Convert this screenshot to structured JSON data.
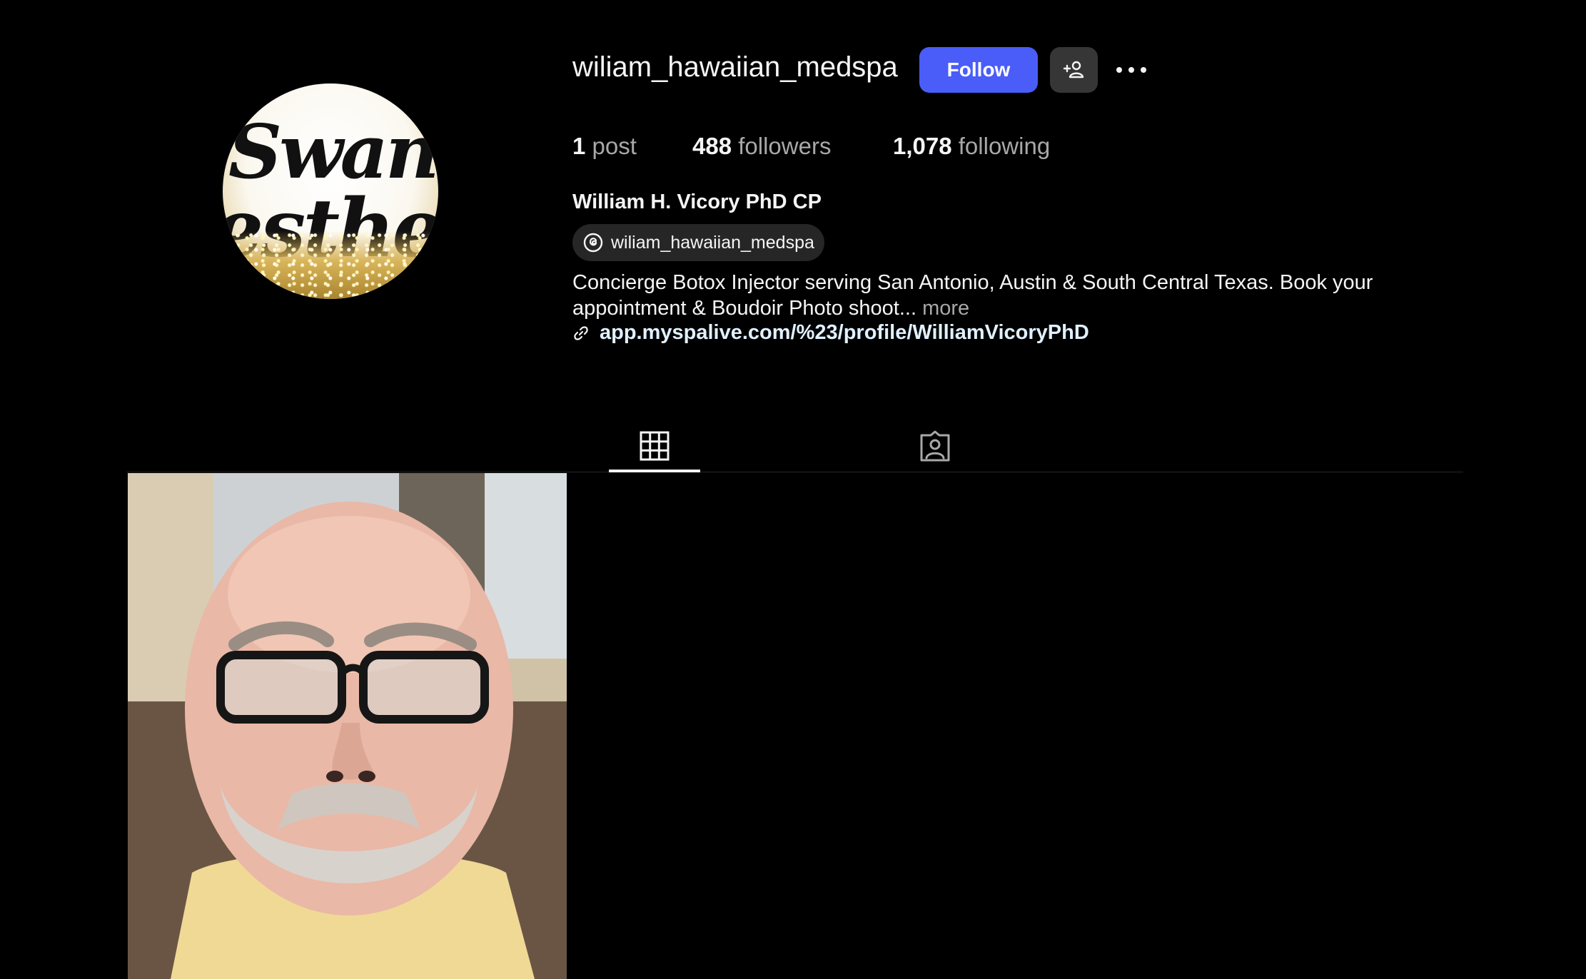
{
  "profile": {
    "username": "wiliam_hawaiian_medspa",
    "full_name": "William H. Vicory PhD CP",
    "avatar_text": [
      "Swank",
      "esthetic"
    ]
  },
  "actions": {
    "follow_label": "Follow",
    "suggest_icon": "add-person-icon",
    "more_icon": "ellipsis-icon"
  },
  "stats": {
    "posts_count": "1",
    "posts_label": "post",
    "followers_count": "488",
    "followers_label": "followers",
    "following_count": "1,078",
    "following_label": "following"
  },
  "threads": {
    "icon": "threads-icon",
    "handle": "wiliam_hawaiian_medspa"
  },
  "bio": {
    "text": "Concierge Botox Injector serving San Antonio, Austin & South Central Texas. Book your appointment & Boudoir Photo shoot...",
    "more_label": "more"
  },
  "link": {
    "icon": "link-icon",
    "url": "app.myspalive.com/%23/profile/WilliamVicoryPhD"
  },
  "tabs": [
    {
      "icon": "grid-icon",
      "selected": true
    },
    {
      "icon": "tagged-icon",
      "selected": false
    }
  ],
  "colors": {
    "background": "#000000",
    "follow_button": "#4a5df9",
    "secondary_button": "#363636",
    "muted_text": "#a8a8a8",
    "link_text": "#e0f1ff"
  }
}
